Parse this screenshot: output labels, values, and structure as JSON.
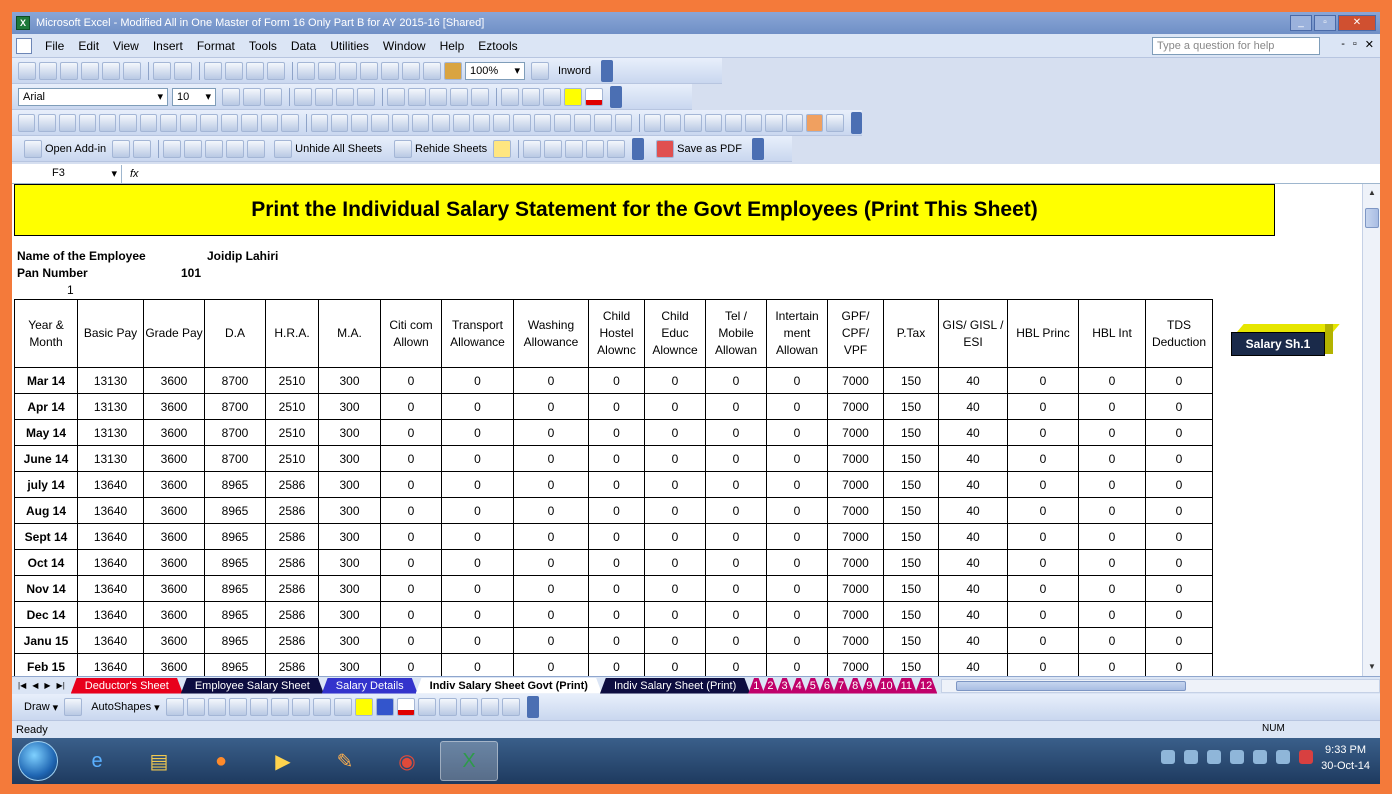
{
  "window": {
    "title": "Microsoft Excel - Modified All in One Master of Form 16 Only Part  B for AY 2015-16  [Shared]"
  },
  "menu": {
    "items": [
      "File",
      "Edit",
      "View",
      "Insert",
      "Format",
      "Tools",
      "Data",
      "Utilities",
      "Window",
      "Help",
      "Eztools"
    ],
    "help_placeholder": "Type a question for help"
  },
  "toolbar": {
    "zoom": "100%",
    "inword": "Inword",
    "font_name": "Arial",
    "font_size": "10",
    "open_addin": "Open Add-in",
    "unhide_all": "Unhide All Sheets",
    "rehide": "Rehide Sheets",
    "save_pdf": "Save as PDF"
  },
  "formula_bar": {
    "name_box": "F3",
    "fx": "fx"
  },
  "sheet": {
    "banner": "Print the Individual Salary Statement for the Govt Employees (Print This Sheet)",
    "employee_label": "Name of the Employee",
    "employee_name": "Joidip Lahiri",
    "pan_label": "Pan Number",
    "pan_value": "101",
    "serial": "1",
    "salary_button": "Salary Sh.1",
    "headers": [
      "Year & Month",
      "Basic Pay",
      "Grade Pay",
      "D.A",
      "H.R.A.",
      "M.A.",
      "Citi com Allown",
      "Transport Allowance",
      "Washing Allowance",
      "Child Hostel Alownc",
      "Child Educ Alownce",
      "Tel / Mobile Allowan",
      "Intertain ment Allowan",
      "GPF/ CPF/ VPF",
      "P.Tax",
      "GIS/ GISL / ESI",
      "HBL  Princ",
      "HBL Int",
      "TDS Deduction"
    ],
    "rows": [
      [
        "Mar 14",
        "13130",
        "3600",
        "8700",
        "2510",
        "300",
        "0",
        "0",
        "0",
        "0",
        "0",
        "0",
        "0",
        "7000",
        "150",
        "40",
        "0",
        "0",
        "0"
      ],
      [
        "Apr 14",
        "13130",
        "3600",
        "8700",
        "2510",
        "300",
        "0",
        "0",
        "0",
        "0",
        "0",
        "0",
        "0",
        "7000",
        "150",
        "40",
        "0",
        "0",
        "0"
      ],
      [
        "May 14",
        "13130",
        "3600",
        "8700",
        "2510",
        "300",
        "0",
        "0",
        "0",
        "0",
        "0",
        "0",
        "0",
        "7000",
        "150",
        "40",
        "0",
        "0",
        "0"
      ],
      [
        "June 14",
        "13130",
        "3600",
        "8700",
        "2510",
        "300",
        "0",
        "0",
        "0",
        "0",
        "0",
        "0",
        "0",
        "7000",
        "150",
        "40",
        "0",
        "0",
        "0"
      ],
      [
        "july 14",
        "13640",
        "3600",
        "8965",
        "2586",
        "300",
        "0",
        "0",
        "0",
        "0",
        "0",
        "0",
        "0",
        "7000",
        "150",
        "40",
        "0",
        "0",
        "0"
      ],
      [
        "Aug 14",
        "13640",
        "3600",
        "8965",
        "2586",
        "300",
        "0",
        "0",
        "0",
        "0",
        "0",
        "0",
        "0",
        "7000",
        "150",
        "40",
        "0",
        "0",
        "0"
      ],
      [
        "Sept 14",
        "13640",
        "3600",
        "8965",
        "2586",
        "300",
        "0",
        "0",
        "0",
        "0",
        "0",
        "0",
        "0",
        "7000",
        "150",
        "40",
        "0",
        "0",
        "0"
      ],
      [
        "Oct 14",
        "13640",
        "3600",
        "8965",
        "2586",
        "300",
        "0",
        "0",
        "0",
        "0",
        "0",
        "0",
        "0",
        "7000",
        "150",
        "40",
        "0",
        "0",
        "0"
      ],
      [
        "Nov 14",
        "13640",
        "3600",
        "8965",
        "2586",
        "300",
        "0",
        "0",
        "0",
        "0",
        "0",
        "0",
        "0",
        "7000",
        "150",
        "40",
        "0",
        "0",
        "0"
      ],
      [
        "Dec 14",
        "13640",
        "3600",
        "8965",
        "2586",
        "300",
        "0",
        "0",
        "0",
        "0",
        "0",
        "0",
        "0",
        "7000",
        "150",
        "40",
        "0",
        "0",
        "0"
      ],
      [
        "Janu 15",
        "13640",
        "3600",
        "8965",
        "2586",
        "300",
        "0",
        "0",
        "0",
        "0",
        "0",
        "0",
        "0",
        "7000",
        "150",
        "40",
        "0",
        "0",
        "0"
      ],
      [
        "Feb 15",
        "13640",
        "3600",
        "8965",
        "2586",
        "300",
        "0",
        "0",
        "0",
        "0",
        "0",
        "0",
        "0",
        "7000",
        "150",
        "40",
        "0",
        "0",
        "0"
      ]
    ]
  },
  "tabs": [
    {
      "label": "Deductor's Sheet",
      "color": "#e8001c",
      "active": false
    },
    {
      "label": "Employee Salary Sheet",
      "color": "#0d0d40",
      "active": false
    },
    {
      "label": "Salary Details",
      "color": "#3333cc",
      "active": false
    },
    {
      "label": "Indiv Salary Sheet Govt (Print)",
      "color": "#ffffff",
      "active": true
    },
    {
      "label": "Indiv Salary Sheet (Print)",
      "color": "#0d0d40",
      "active": false
    },
    {
      "label": "1",
      "color": "#c0006a",
      "active": false
    },
    {
      "label": "2",
      "color": "#c0006a",
      "active": false
    },
    {
      "label": "3",
      "color": "#c0006a",
      "active": false
    },
    {
      "label": "4",
      "color": "#c0006a",
      "active": false
    },
    {
      "label": "5",
      "color": "#c0006a",
      "active": false
    },
    {
      "label": "6",
      "color": "#c0006a",
      "active": false
    },
    {
      "label": "7",
      "color": "#c0006a",
      "active": false
    },
    {
      "label": "8",
      "color": "#c0006a",
      "active": false
    },
    {
      "label": "9",
      "color": "#c0006a",
      "active": false
    },
    {
      "label": "10",
      "color": "#c0006a",
      "active": false
    },
    {
      "label": "11",
      "color": "#c0006a",
      "active": false
    },
    {
      "label": "12",
      "color": "#c0006a",
      "active": false
    }
  ],
  "drawbar": {
    "draw": "Draw",
    "autoshapes": "AutoShapes"
  },
  "status": {
    "ready": "Ready",
    "num": "NUM"
  },
  "taskbar": {
    "time": "9:33 PM",
    "date": "30-Oct-14"
  }
}
